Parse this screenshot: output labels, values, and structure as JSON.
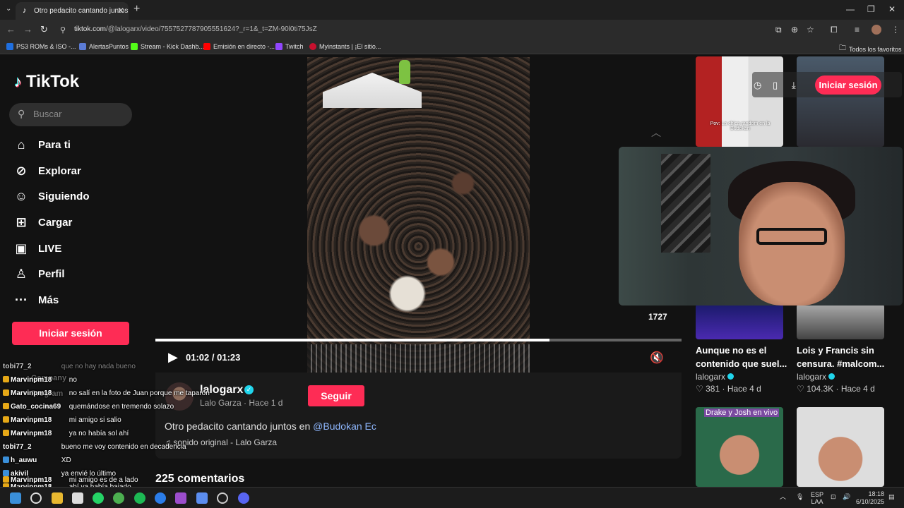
{
  "browser": {
    "tab_title": "Otro pedacito cantando juntos",
    "url_domain": "tiktok.com",
    "url_path": "/@lalogarx/video/7557527787905551624?_r=1&_t=ZM-90l0ti75JsZ",
    "bookmarks": [
      {
        "label": "PS3 ROMs & ISO -...",
        "color": "#1f6fe0"
      },
      {
        "label": "AlertasPuntos",
        "color": "#5b7bd5"
      },
      {
        "label": "Stream - Kick Dashb...",
        "color": "#53fc18"
      },
      {
        "label": "Emisión en directo -...",
        "color": "#ff0000"
      },
      {
        "label": "Twitch",
        "color": "#9146ff"
      },
      {
        "label": "Myinstants | ¡El sitio...",
        "color": "#c8102e"
      }
    ],
    "favorites_label": "Todos los favoritos"
  },
  "sidebar": {
    "logo": "TikTok",
    "search_placeholder": "Buscar",
    "items": [
      {
        "label": "Para ti",
        "icon": "home-icon",
        "glyph": "⌂"
      },
      {
        "label": "Explorar",
        "icon": "compass-icon",
        "glyph": "⊘"
      },
      {
        "label": "Siguiendo",
        "icon": "user-follow-icon",
        "glyph": "☺"
      },
      {
        "label": "Cargar",
        "icon": "upload-icon",
        "glyph": "⊞"
      },
      {
        "label": "LIVE",
        "icon": "live-icon",
        "glyph": "▣"
      },
      {
        "label": "Perfil",
        "icon": "profile-icon",
        "glyph": "♙"
      },
      {
        "label": "Más",
        "icon": "more-icon",
        "glyph": "···"
      }
    ],
    "login_label": "Iniciar sesión"
  },
  "video": {
    "progress_fraction": 0.7485,
    "current_time": "01:02",
    "duration": "01:23",
    "time_separator": "/"
  },
  "author": {
    "username": "lalogarx",
    "display_name": "Lalo Garza",
    "posted": "Hace 1 d",
    "follow_label": "Seguir",
    "caption_text": "Otro pedacito cantando juntos en",
    "caption_tag": "@Budokan Ec",
    "sound": "sonido original - Lalo Garza",
    "comments_count": "225 comentarios"
  },
  "right": {
    "login_label": "Iniciar sesión",
    "top_count": "1727",
    "thumb1_text": "Pov: La chica random en la Budokan",
    "cards": [
      {
        "caption": "Aunque no es el contenido que suel...",
        "author": "lalogarx",
        "likes": "381",
        "ago": "Hace 4 d"
      },
      {
        "caption": "Lois y Francis sin censura. #malcom...",
        "author": "lalogarx",
        "likes": "104.3K",
        "ago": "Hace 4 d"
      }
    ],
    "thumb_bottom_text": "Drake y Josh en vivo"
  },
  "chat": [
    {
      "user": "tobi77_2",
      "text": "que no hay nada bueno",
      "badge": "none"
    },
    {
      "user": "Marvinpm18",
      "text": "no",
      "badge": "gold"
    },
    {
      "user": "Marvinpm18",
      "text": "no salí en la foto de Juan porque me taparon",
      "badge": "gold"
    },
    {
      "user": "Gato_cocina69",
      "text": "quemándose en tremendo solazo",
      "badge": "gold"
    },
    {
      "user": "Marvinpm18",
      "text": "mi amigo si salio",
      "badge": "gold"
    },
    {
      "user": "Marvinpm18",
      "text": "ya no había sol ahí",
      "badge": "gold"
    },
    {
      "user": "tobi77_2",
      "text": "bueno me voy contenido en decadencia",
      "badge": "none"
    },
    {
      "user": "h_auwu",
      "text": "XD",
      "badge": "blue"
    },
    {
      "user": "akivil",
      "text": "ya envié lo último",
      "badge": "blue"
    },
    {
      "user": "Marvinpm18",
      "text": "ahí ya había bajado",
      "badge": "gold"
    },
    {
      "user": "Marvinpm18",
      "text": "mi amigo es de a lado",
      "badge": "gold"
    }
  ],
  "chat_ghost": [
    "Company",
    "Program"
  ],
  "taskbar": {
    "lang_top": "ESP",
    "lang_bottom": "LAA",
    "time": "18:18",
    "date": "6/10/2025"
  }
}
